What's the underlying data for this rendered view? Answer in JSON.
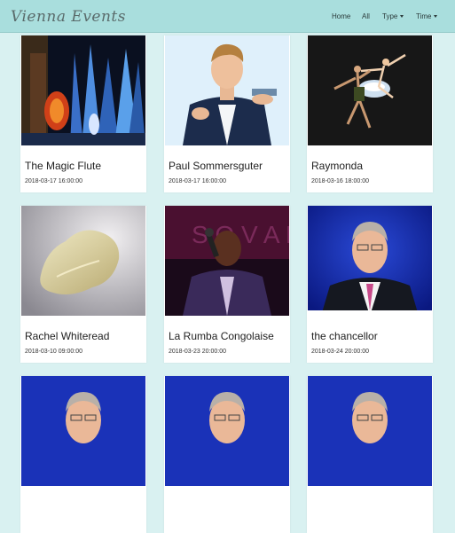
{
  "app": {
    "brand": "Vienna Events"
  },
  "nav": {
    "home": "Home",
    "all": "All",
    "type": "Type",
    "time": "Time"
  },
  "events": [
    {
      "title": "The Magic Flute",
      "date": "2018-03-17 16:00:00",
      "image": "opera-stage-blue-curtains"
    },
    {
      "title": "Paul Sommersguter",
      "date": "2018-03-17 16:00:00",
      "image": "performer-portrait"
    },
    {
      "title": "Raymonda",
      "date": "2018-03-16 18:00:00",
      "image": "ballet-dancers"
    },
    {
      "title": "Rachel Whiteread",
      "date": "2018-03-10 09:00:00",
      "image": "sculpture-cast"
    },
    {
      "title": "La Rumba Congolaise",
      "date": "2018-03-23 20:00:00",
      "image": "singer-on-stage"
    },
    {
      "title": "the chancellor",
      "date": "2018-03-24 20:00:00",
      "image": "man-portrait-blue"
    },
    {
      "title": "",
      "date": "",
      "image": "man-portrait-blue"
    },
    {
      "title": "",
      "date": "",
      "image": "man-portrait-blue"
    },
    {
      "title": "",
      "date": "",
      "image": "man-portrait-blue"
    }
  ]
}
